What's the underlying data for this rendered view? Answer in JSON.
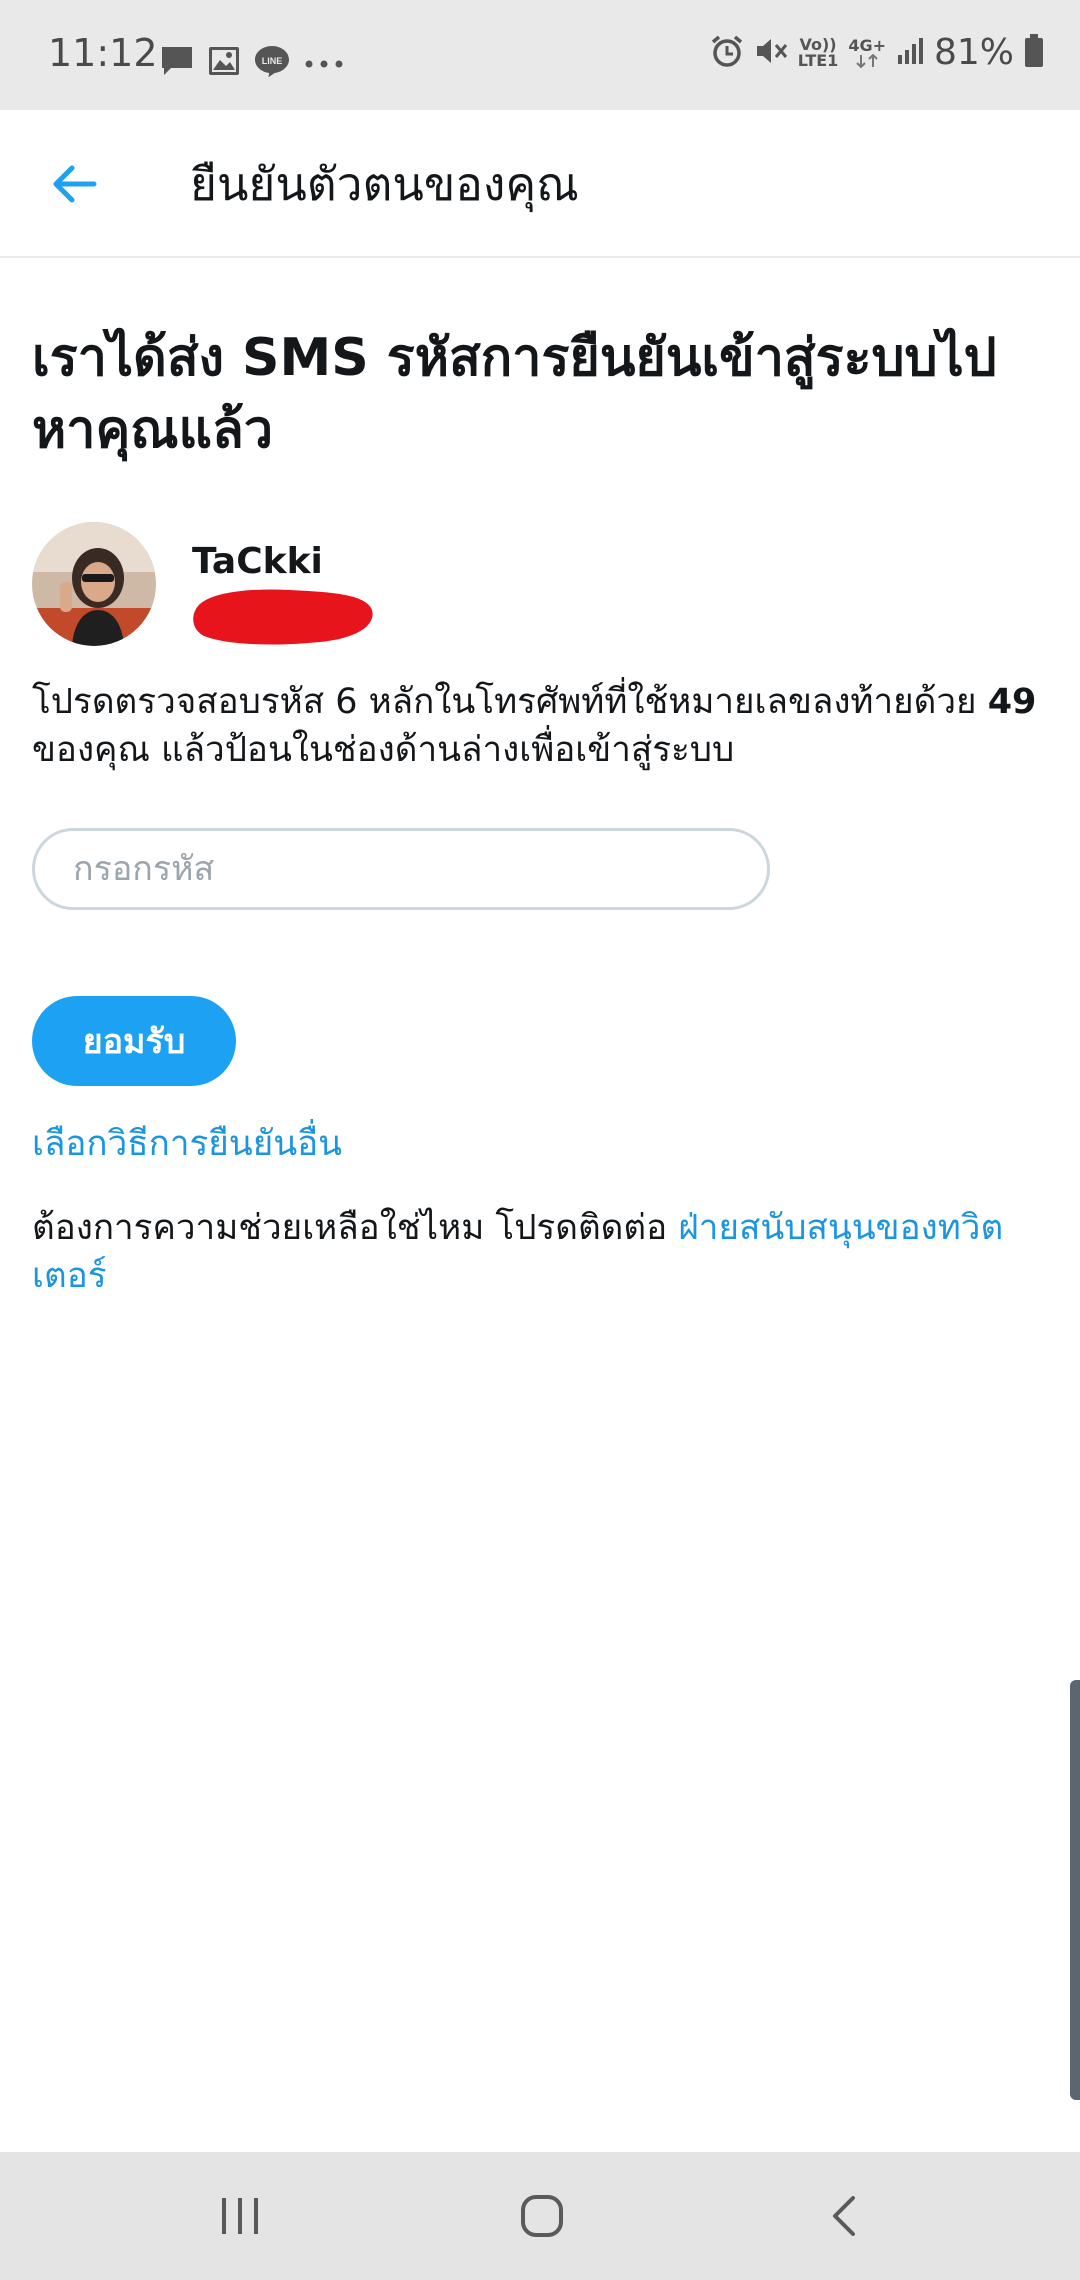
{
  "status_bar": {
    "time": "11:12",
    "icons_left": [
      "message-icon",
      "gallery-icon",
      "line-icon",
      "more-icon"
    ],
    "volte_label_top": "Vo))",
    "volte_label_bottom": "LTE1",
    "network_label": "4G+",
    "battery_percent": "81%",
    "icons_right": [
      "alarm-icon",
      "mute-icon",
      "volte-icon",
      "network-4g-icon",
      "signal-icon",
      "battery-icon"
    ]
  },
  "app_bar": {
    "back_icon": "back-arrow-icon",
    "title": "ยืนยันตัวตนของคุณ"
  },
  "main": {
    "headline": "เราได้ส่ง SMS รหัสการยืนยันเข้าสู่ระบบไปหาคุณแล้ว",
    "user": {
      "name": "TaCkki"
    },
    "instructions_before": "โปรดตรวจสอบรหัส 6 หลักในโทรศัพท์ที่ใช้หมายเลขลงท้ายด้วย ",
    "instructions_digits": "49",
    "instructions_after": " ของคุณ แล้วป้อนในช่องด้านล่างเพื่อเข้าสู่ระบบ",
    "code_input": {
      "placeholder": "กรอกรหัส",
      "value": ""
    },
    "accept_button": "ยอมรับ",
    "alt_method_link": "เลือกวิธีการยืนยันอื่น",
    "help_text": "ต้องการความช่วยเหลือใช่ไหม โปรดติดต่อ ",
    "help_link": "ฝ่ายสนับสนุนของทวิตเตอร์"
  },
  "nav_bar": {
    "buttons": [
      "recent-apps-icon",
      "home-icon",
      "back-icon"
    ]
  },
  "colors": {
    "accent": "#1da1f2",
    "link": "#1b95e0",
    "text": "#14171a",
    "status_bar_bg": "#e9e9e9",
    "nav_bar_bg": "#e4e4e4",
    "redaction": "#e8141c"
  }
}
